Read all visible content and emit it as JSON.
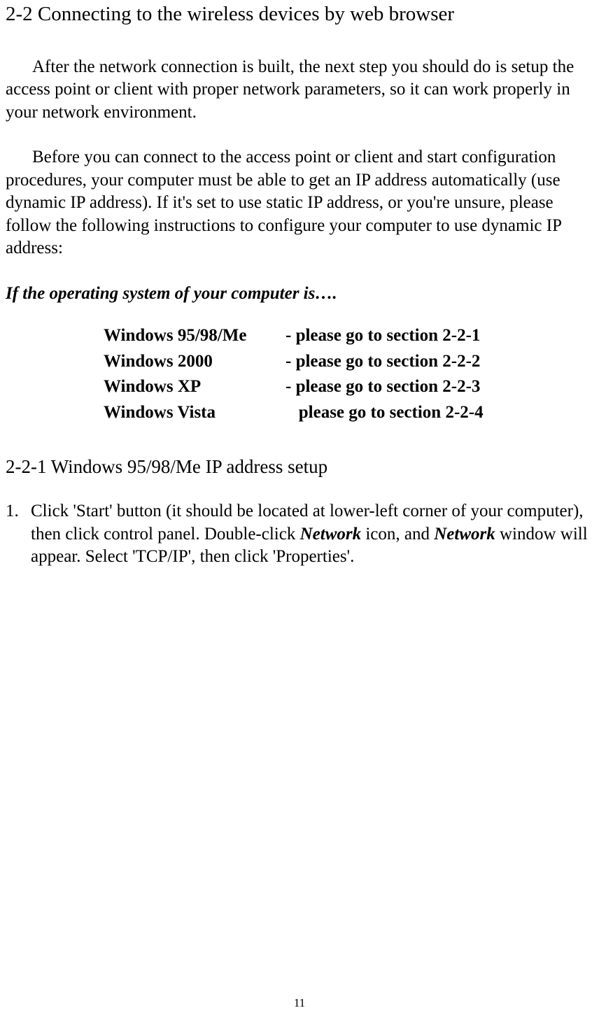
{
  "section_title": "2-2 Connecting to the wireless devices by web browser",
  "para1": "After the network connection is built, the next step you should do is setup the access point or client with proper network parameters, so it can work properly in your network environment.",
  "para2": "Before you can connect to the access point or client and start configuration procedures, your computer must be able to get an IP address automatically (use dynamic IP address). If it's set to use static IP address, or you're unsure, please follow the following instructions to configure your computer to use dynamic IP address:",
  "os_intro": "If the operating system of your computer is….",
  "os_list": [
    {
      "name": "Windows 95/98/Me",
      "action": "- please go to section 2-2-1"
    },
    {
      "name": "Windows 2000",
      "action": "- please go to section 2-2-2"
    },
    {
      "name": "Windows XP",
      "action": "- please go to section 2-2-3"
    },
    {
      "name": "Windows Vista",
      "action": "   please go to section 2-2-4"
    }
  ],
  "sub_section_title": "2-2-1 Windows 95/98/Me IP address setup",
  "step1": {
    "number": "1.",
    "pre": "Click 'Start' button (it should be located at lower-left corner of your computer), then click control panel. Double-click ",
    "em1": "Network",
    "mid": " icon, and ",
    "em2": "Network",
    "post": " window will appear. Select 'TCP/IP', then click 'Properties'."
  },
  "page_number": "11"
}
